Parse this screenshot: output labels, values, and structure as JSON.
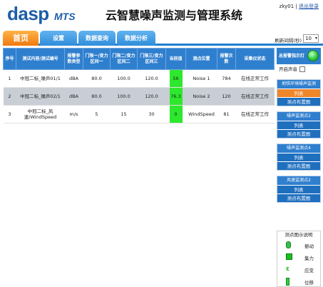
{
  "header": {
    "logo": "dasp",
    "logo_sub": "MTS",
    "title": "云智慧噪声监测与管理系统",
    "user": "zky01",
    "sep": " | ",
    "logout": "退出登录"
  },
  "nav": {
    "tabs": [
      {
        "label": "首页",
        "active": true
      },
      {
        "label": "设置",
        "active": false
      },
      {
        "label": "数据查询",
        "active": false
      },
      {
        "label": "数据分析",
        "active": false
      }
    ],
    "refresh_label": "刷新间隔(秒)",
    "refresh_value": "10"
  },
  "table": {
    "columns": [
      "序号",
      "测试内容/测试编号",
      "报警参数类型",
      "门限一/变力区间一",
      "门限二/变力区间二",
      "门限三/变力区间三",
      "当前值",
      "测点位置",
      "报警次数",
      "采集仪状态"
    ],
    "rows": [
      {
        "no": "1",
        "name": "中冠二标_噪声01/1",
        "type": "dBA",
        "t1": "80.0",
        "t2": "100.0",
        "t3": "120.0",
        "current": "56",
        "location": "Noise 1",
        "count": "784",
        "status": "在线正常工作"
      },
      {
        "no": "2",
        "name": "中冠二标_噪声02/1",
        "type": "dBA",
        "t1": "80.0",
        "t2": "100.0",
        "t3": "120.0",
        "current": "76.3",
        "location": "Noise 2",
        "count": "120",
        "status": "在线正常工作"
      },
      {
        "no": "3",
        "name": "中冠二标_风速/WindSpeed",
        "type": "m/s",
        "t1": "5",
        "t2": "15",
        "t3": "30",
        "current": "0",
        "location": "WindSpeed",
        "count": "81",
        "status": "在线正常工作"
      }
    ]
  },
  "panel": {
    "alarm_label": "总报警指示灯",
    "sound_label": "开启声音",
    "groups": [
      {
        "title": "地铁环境噪声监测",
        "buttons": [
          "列表",
          "测点布置图"
        ]
      },
      {
        "title": "噪声监测点2",
        "buttons": [
          "列表",
          "测点布置图"
        ]
      },
      {
        "title": "噪声监测点4",
        "buttons": [
          "列表",
          "测点布置图"
        ]
      },
      {
        "title": "风速监测点2",
        "buttons": [
          "列表",
          "测点布置图"
        ]
      }
    ],
    "legend": {
      "title": "测点图示说明",
      "items": [
        {
          "icon": "vibration-icon",
          "label": "振动"
        },
        {
          "icon": "force-icon",
          "label": "集力"
        },
        {
          "icon": "strain-icon",
          "label": "应变"
        },
        {
          "icon": "displacement-icon",
          "label": "位移"
        }
      ]
    }
  },
  "colors": {
    "primary": "#2f7fcf",
    "active_tab": "#f07a10",
    "current_ok": "#2de82d",
    "row_alt": "#c9ced6"
  }
}
